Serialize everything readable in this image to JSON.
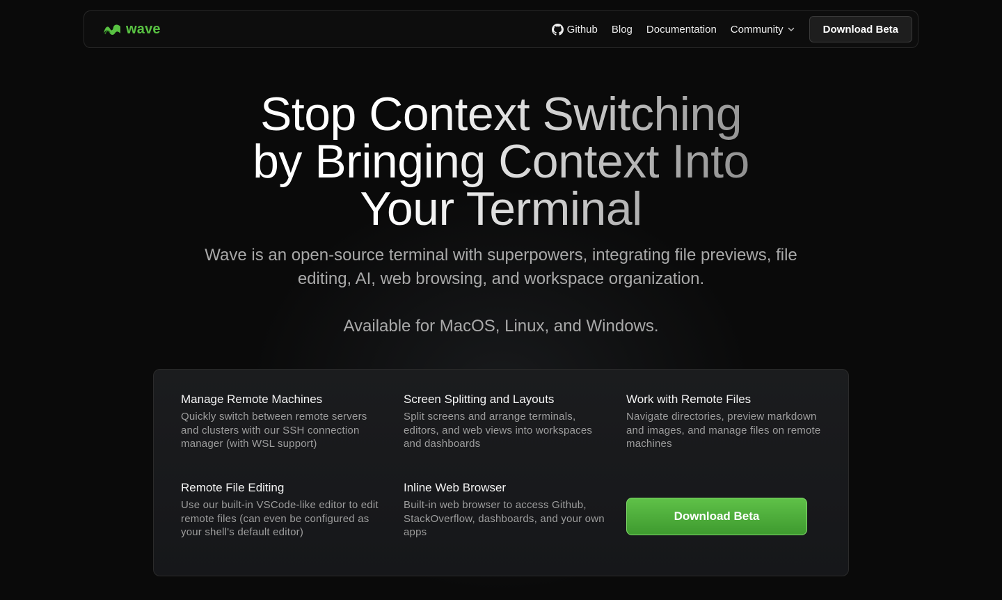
{
  "nav": {
    "logo_text": "wave",
    "links": [
      {
        "label": "Github",
        "icon": "github-icon"
      },
      {
        "label": "Blog"
      },
      {
        "label": "Documentation"
      },
      {
        "label": "Community",
        "icon": "chevron-down-icon"
      }
    ],
    "cta_label": "Download Beta"
  },
  "hero": {
    "title_lines": [
      "Stop Context Switching",
      "by Bringing Context Into",
      "Your Terminal"
    ],
    "subtitle": "Wave is an open-source terminal with superpowers, integrating file previews, file editing, AI, web browsing, and workspace organization.",
    "availability": "Available for MacOS, Linux, and Windows."
  },
  "features": [
    {
      "title": "Manage Remote Machines",
      "desc": "Quickly switch between remote servers and clusters with our SSH connection manager (with WSL support)"
    },
    {
      "title": "Screen Splitting and Layouts",
      "desc": "Split screens and arrange terminals, editors, and web views into workspaces and dashboards"
    },
    {
      "title": "Work with Remote Files",
      "desc": "Navigate directories, preview markdown and images, and manage files on remote machines"
    },
    {
      "title": "Remote File Editing",
      "desc": "Use our built-in VSCode-like editor to edit remote files (can even be configured as your shell's default editor)"
    },
    {
      "title": "Inline Web Browser",
      "desc": "Built-in web browser to access Github, StackOverflow, dashboards, and your own apps"
    }
  ],
  "cta": {
    "label": "Download Beta"
  },
  "colors": {
    "brand": "#58c142",
    "cta_top": "#5fc148",
    "cta_bottom": "#3e9a2f",
    "background": "#0a0a0a"
  }
}
